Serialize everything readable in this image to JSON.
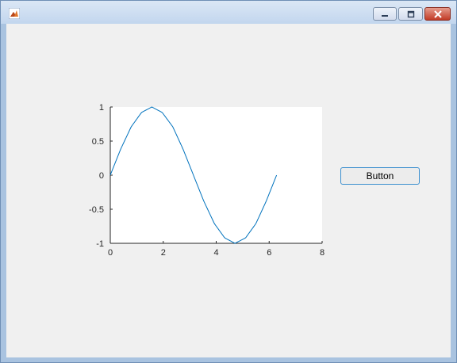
{
  "window": {
    "app_icon": "matlab-icon",
    "controls": {
      "minimize_icon": "minimize-icon",
      "maximize_icon": "maximize-icon",
      "close_icon": "close-icon"
    },
    "colors": {
      "titlebar": "#c9dbf0",
      "close": "#c8402b",
      "client_bg": "#f0f0f0"
    }
  },
  "button": {
    "label": "Button",
    "border_color": "#3c8fcf"
  },
  "chart_data": {
    "type": "line",
    "title": "",
    "xlabel": "",
    "ylabel": "",
    "xlim": [
      0,
      8
    ],
    "ylim": [
      -1,
      1
    ],
    "xticks": [
      0,
      2,
      4,
      6,
      8
    ],
    "xtick_labels": [
      "0",
      "2",
      "4",
      "6",
      "8"
    ],
    "yticks": [
      -1,
      -0.5,
      0,
      0.5,
      1
    ],
    "ytick_labels": [
      "-1",
      "-0.5",
      "0",
      "0.5",
      "1"
    ],
    "grid": false,
    "series": [
      {
        "color": "#0072bd",
        "x": [
          0,
          0.39,
          0.79,
          1.18,
          1.57,
          1.96,
          2.36,
          2.75,
          3.14,
          3.53,
          3.93,
          4.32,
          4.71,
          5.11,
          5.5,
          5.89,
          6.28
        ],
        "y": [
          0,
          0.38,
          0.71,
          0.92,
          1,
          0.92,
          0.71,
          0.38,
          0,
          -0.38,
          -0.71,
          -0.92,
          -1,
          -0.92,
          -0.71,
          -0.38,
          0
        ]
      }
    ]
  }
}
